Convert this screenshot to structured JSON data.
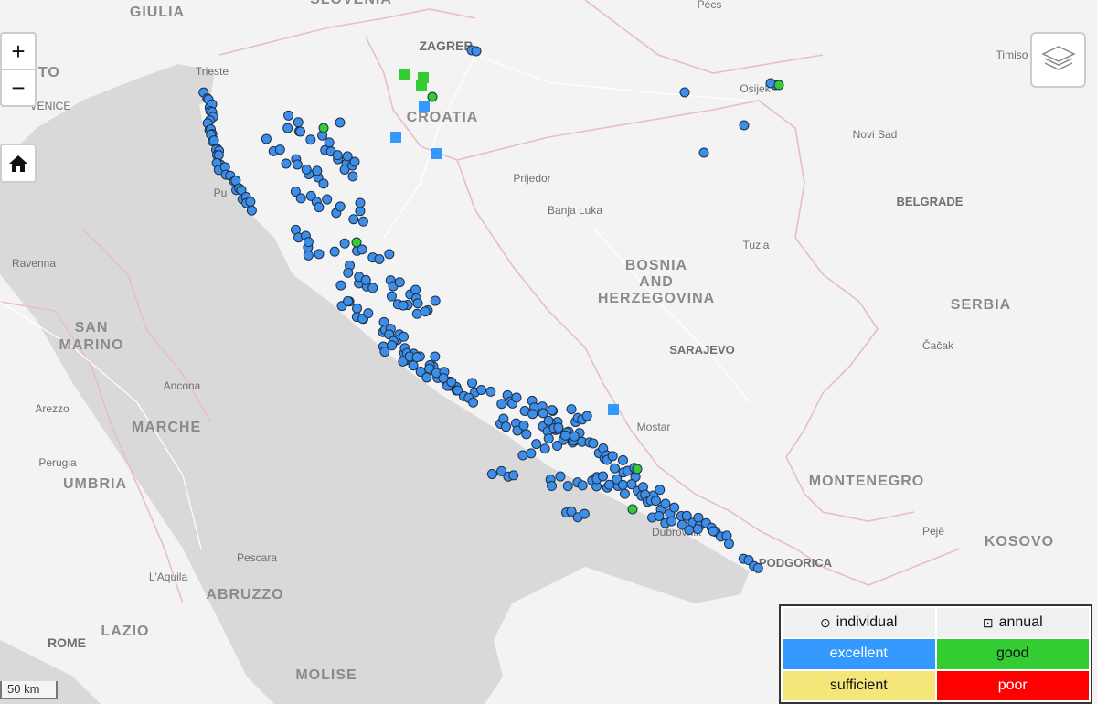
{
  "map": {
    "countries": [
      {
        "name": "SLOVENIA"
      },
      {
        "name": "CROATIA"
      },
      {
        "name": "BOSNIA"
      },
      {
        "name": "AND"
      },
      {
        "name": "HERZEGOVINA"
      },
      {
        "name": "SERBIA"
      },
      {
        "name": "MONTENEGRO"
      },
      {
        "name": "KOSOVO"
      }
    ],
    "regions": [
      {
        "name": "GIULIA"
      },
      {
        "name": "SAN"
      },
      {
        "name": "MARINO"
      },
      {
        "name": "MARCHE"
      },
      {
        "name": "UMBRIA"
      },
      {
        "name": "ABRUZZO"
      },
      {
        "name": "LAZIO"
      },
      {
        "name": "MOLISE"
      },
      {
        "name": "ETO"
      }
    ],
    "cities": [
      {
        "name": "Trieste"
      },
      {
        "name": "VENICE"
      },
      {
        "name": "Pu"
      },
      {
        "name": "Ravenna"
      },
      {
        "name": "Ancona"
      },
      {
        "name": "Arezzo"
      },
      {
        "name": "Perugia"
      },
      {
        "name": "Pescara"
      },
      {
        "name": "L'Aquila"
      },
      {
        "name": "ROME"
      },
      {
        "name": "ZAGREB"
      },
      {
        "name": "Osijek"
      },
      {
        "name": "Pécs"
      },
      {
        "name": "Timiso"
      },
      {
        "name": "Novi Sad"
      },
      {
        "name": "BELGRADE"
      },
      {
        "name": "Prijedor"
      },
      {
        "name": "Banja Luka"
      },
      {
        "name": "Tuzla"
      },
      {
        "name": "SARAJEVO"
      },
      {
        "name": "Čačak"
      },
      {
        "name": "Mostar"
      },
      {
        "name": "Dubrovnik"
      },
      {
        "name": "PODGORICA"
      },
      {
        "name": "Pejë"
      }
    ]
  },
  "controls": {
    "zoom_in": "+",
    "zoom_out": "−",
    "home_icon": "home-icon",
    "layers_icon": "layers-icon"
  },
  "scale": {
    "label": "50 km"
  },
  "legend": {
    "individual": {
      "glyph": "⊙",
      "label": "individual"
    },
    "annual": {
      "glyph": "⊡",
      "label": "annual"
    },
    "classes": [
      {
        "label": "excellent",
        "color": "#3399ff",
        "text": "#ffffff"
      },
      {
        "label": "good",
        "color": "#33cc33",
        "text": "#111111"
      },
      {
        "label": "sufficient",
        "color": "#f5e67a",
        "text": "#111111"
      },
      {
        "label": "poor",
        "color": "#ff0000",
        "text": "#ffffff"
      }
    ]
  },
  "colors": {
    "sea": "#d6d6d6",
    "land": "#f3f3f3",
    "border": "#e6b6c4",
    "point_fill": "#3d8ee8",
    "point_stroke": "#1f2f46"
  }
}
